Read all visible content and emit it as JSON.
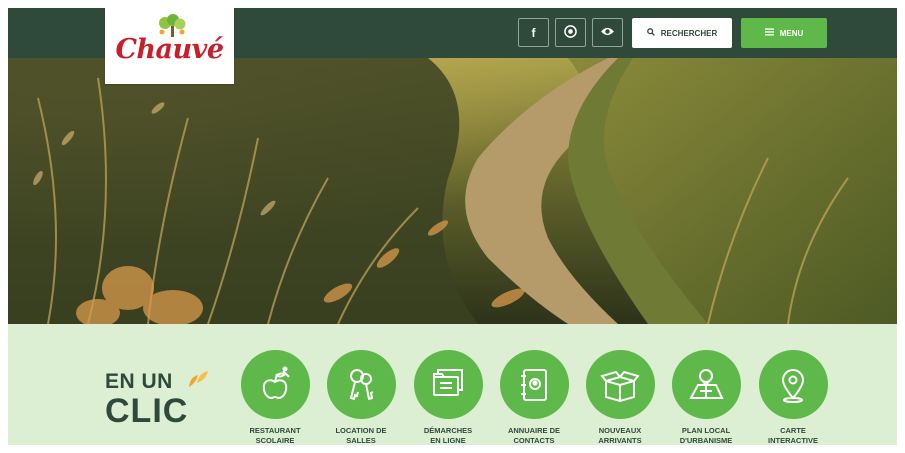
{
  "header": {
    "logo_text": "Chauvé",
    "social": [
      {
        "icon": "facebook-icon",
        "glyph": "f"
      },
      {
        "icon": "globe-icon",
        "glyph": "◉"
      },
      {
        "icon": "eye-icon",
        "glyph": "◈"
      }
    ],
    "search_label": "RECHERCHER",
    "menu_label": "MENU"
  },
  "hero": {
    "alt": ""
  },
  "en_un_clic": {
    "title_line1": "EN UN",
    "title_line2": "CLIC",
    "items": [
      {
        "icon": "apple-icon",
        "line1": "RESTAURANT",
        "line2": "SCOLAIRE"
      },
      {
        "icon": "keys-icon",
        "line1": "LOCATION DE",
        "line2": "SALLES"
      },
      {
        "icon": "folders-icon",
        "line1": "DÉMARCHES",
        "line2": "EN LIGNE"
      },
      {
        "icon": "contacts-book-icon",
        "line1": "ANNUAIRE DE",
        "line2": "CONTACTS"
      },
      {
        "icon": "moving-box-icon",
        "line1": "NOUVEAUX",
        "line2": "ARRIVANTS"
      },
      {
        "icon": "map-plan-icon",
        "line1": "PLAN LOCAL",
        "line2": "D'URBANISME"
      },
      {
        "icon": "map-pin-icon",
        "line1": "CARTE",
        "line2": "INTERACTIVE"
      }
    ]
  },
  "colors": {
    "header_bg": "#2f4a3b",
    "accent_green": "#5fb84a",
    "section_bg": "#dcefd3",
    "logo_red": "#c8202b"
  }
}
